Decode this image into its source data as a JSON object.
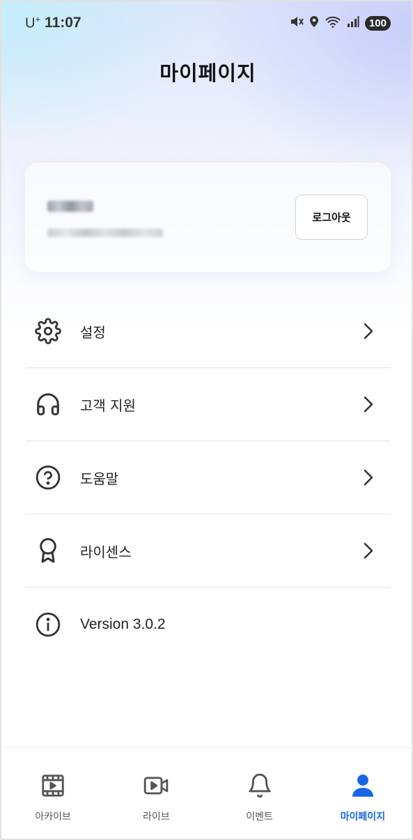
{
  "status_bar": {
    "carrier": "U",
    "carrier_sup": "+",
    "time": "11:07",
    "battery": "100",
    "icons": [
      "mute-icon",
      "location-icon",
      "wifi-icon",
      "signal-icon",
      "battery-icon"
    ]
  },
  "header": {
    "title": "마이페이지"
  },
  "profile": {
    "logout_label": "로그아웃"
  },
  "menu": {
    "items": [
      {
        "label": "설정",
        "icon": "gear-icon"
      },
      {
        "label": "고객 지원",
        "icon": "headphones-icon"
      },
      {
        "label": "도움말",
        "icon": "help-circle-icon"
      },
      {
        "label": "라이센스",
        "icon": "award-icon"
      },
      {
        "label": "Version 3.0.2",
        "icon": "info-icon"
      }
    ]
  },
  "tab_bar": {
    "active_color": "#1866e6",
    "inactive_color": "#555555",
    "tabs": [
      {
        "label": "아카이브",
        "icon": "film-icon"
      },
      {
        "label": "라이브",
        "icon": "video-icon"
      },
      {
        "label": "이벤트",
        "icon": "bell-icon"
      },
      {
        "label": "마이페이지",
        "icon": "user-icon",
        "active": true
      }
    ]
  }
}
